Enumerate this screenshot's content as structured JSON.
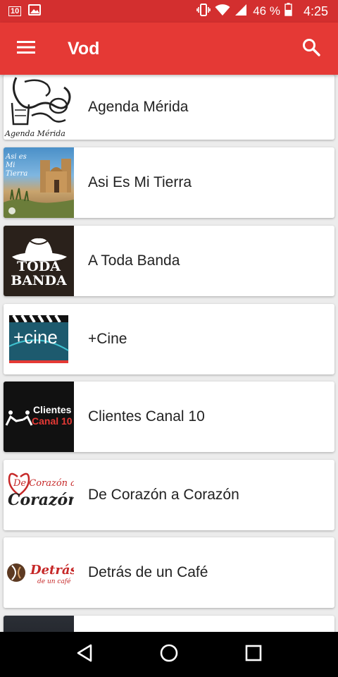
{
  "status_bar": {
    "badge": "10",
    "battery_percent": "46 %",
    "time": "4:25"
  },
  "app_bar": {
    "title": "Vod"
  },
  "list": {
    "items": [
      {
        "title": "Agenda Mérida",
        "thumb_text": "Agenda Mérida"
      },
      {
        "title": "Asi Es Mi Tierra",
        "thumb_text": "Asi es Mi Tierra"
      },
      {
        "title": "A Toda Banda",
        "thumb_text": "TODA BANDA"
      },
      {
        "title": "+Cine",
        "thumb_text": "+cine"
      },
      {
        "title": "Clientes Canal 10",
        "thumb_text_1": "Clientes",
        "thumb_text_2": "Canal 10"
      },
      {
        "title": "De Corazón a Corazón",
        "thumb_text_1": "De Corazón a",
        "thumb_text_2": "Corazón"
      },
      {
        "title": "Detrás de un Café",
        "thumb_text_1": "Detrás",
        "thumb_text_2": "de un café"
      }
    ]
  },
  "colors": {
    "status_bar": "#d32f2f",
    "app_bar": "#e53935",
    "background": "#ececec"
  }
}
